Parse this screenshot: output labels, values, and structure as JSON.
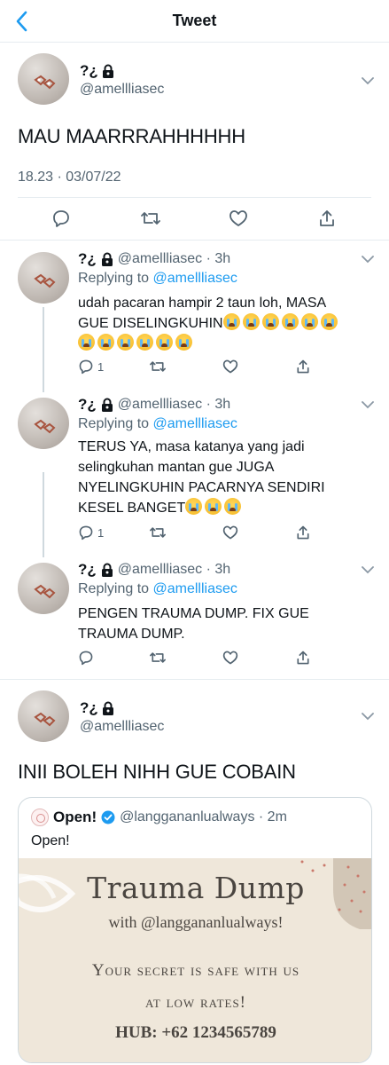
{
  "header": {
    "title": "Tweet"
  },
  "main_tweet": {
    "name": "?¿",
    "handle": "@amellliasec",
    "text": "MAU MAARRRAHHHHHH",
    "timestamp": "18.23 · 03/07/22"
  },
  "replies": [
    {
      "name": "?¿",
      "handle_time": "@amellliasec · 3h",
      "replying_prefix": "Replying to",
      "replying_to": "@amellliasec",
      "body_lines": [
        "udah pacaran hampir 2 taun loh, MASA",
        "GUE DISELINGKUHIN"
      ],
      "reply_count": "1"
    },
    {
      "name": "?¿",
      "handle_time": "@amellliasec · 3h",
      "replying_prefix": "Replying to",
      "replying_to": "@amellliasec",
      "body_lines": [
        "TERUS YA, masa katanya yang jadi",
        "selingkuhan mantan gue JUGA",
        "NYELINGKUHIN PACARNYA SENDIRI",
        "KESEL BANGET"
      ],
      "reply_count": "1"
    },
    {
      "name": "?¿",
      "handle_time": "@amellliasec · 3h",
      "replying_prefix": "Replying to",
      "replying_to": "@amellliasec",
      "body_lines": [
        "PENGEN TRAUMA DUMP. FIX GUE",
        "TRAUMA DUMP."
      ],
      "reply_count": ""
    }
  ],
  "last_tweet": {
    "name": "?¿",
    "handle": "@amellliasec",
    "text": "INII BOLEH NIHH GUE COBAIN"
  },
  "quote": {
    "name": "Open!",
    "handle_time": "@langgananlualways · 2m",
    "text": "Open!",
    "image": {
      "title": "Trauma Dump",
      "subtitle": "with @langgananlualways!",
      "line1": "Your secret is safe with us",
      "line2": "at low rates!",
      "hub": "HUB: +62 1234565789"
    }
  },
  "colors": {
    "link": "#1d9bf0",
    "secondary_text": "#536471",
    "divider": "#e6ecf0"
  },
  "icons": [
    "back-arrow-icon",
    "lock-icon",
    "chevron-down-icon",
    "reply-icon",
    "retweet-icon",
    "like-icon",
    "share-icon",
    "verified-icon",
    "crying-emoji-icon"
  ]
}
